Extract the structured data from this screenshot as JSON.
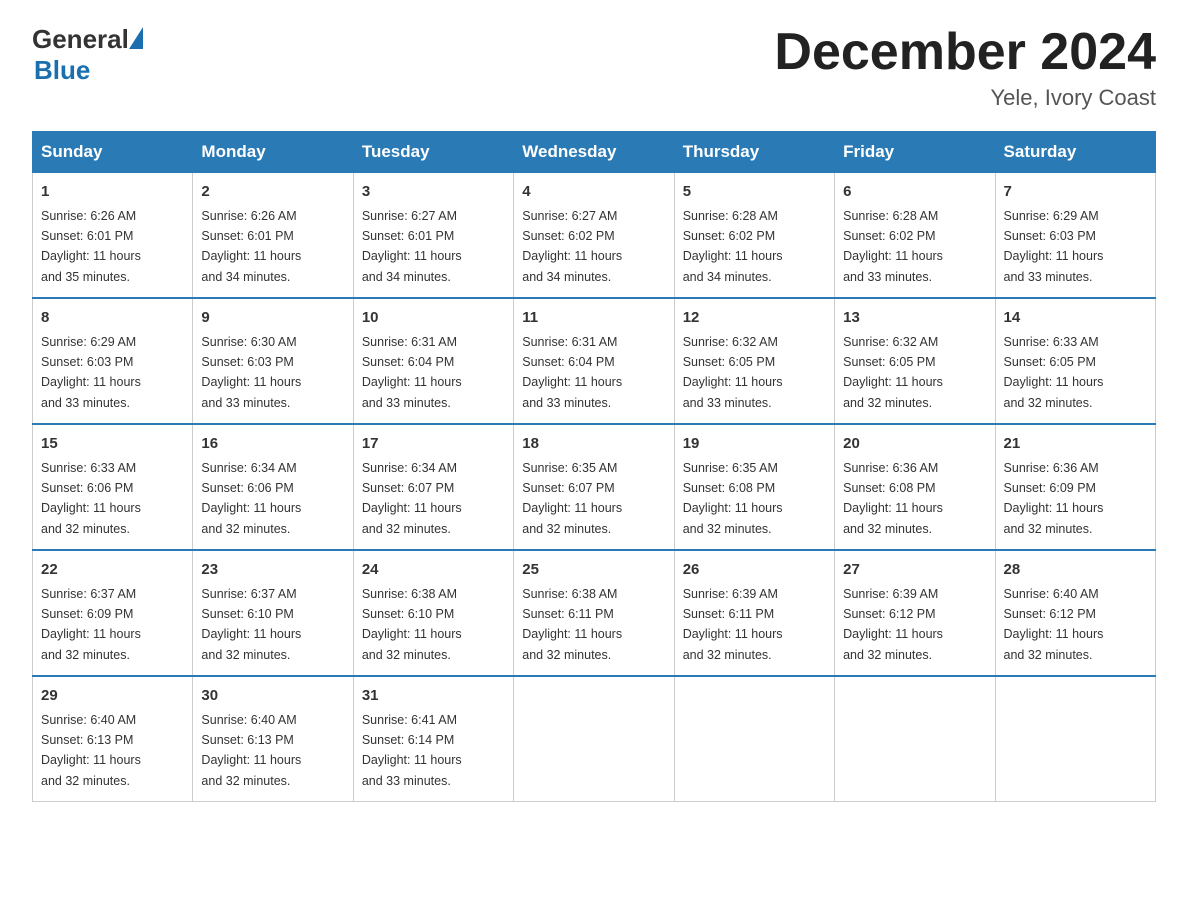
{
  "header": {
    "logo_general": "General",
    "logo_blue": "Blue",
    "month_title": "December 2024",
    "location": "Yele, Ivory Coast"
  },
  "days_of_week": [
    "Sunday",
    "Monday",
    "Tuesday",
    "Wednesday",
    "Thursday",
    "Friday",
    "Saturday"
  ],
  "weeks": [
    [
      {
        "day": "1",
        "sunrise": "6:26 AM",
        "sunset": "6:01 PM",
        "daylight": "11 hours and 35 minutes."
      },
      {
        "day": "2",
        "sunrise": "6:26 AM",
        "sunset": "6:01 PM",
        "daylight": "11 hours and 34 minutes."
      },
      {
        "day": "3",
        "sunrise": "6:27 AM",
        "sunset": "6:01 PM",
        "daylight": "11 hours and 34 minutes."
      },
      {
        "day": "4",
        "sunrise": "6:27 AM",
        "sunset": "6:02 PM",
        "daylight": "11 hours and 34 minutes."
      },
      {
        "day": "5",
        "sunrise": "6:28 AM",
        "sunset": "6:02 PM",
        "daylight": "11 hours and 34 minutes."
      },
      {
        "day": "6",
        "sunrise": "6:28 AM",
        "sunset": "6:02 PM",
        "daylight": "11 hours and 33 minutes."
      },
      {
        "day": "7",
        "sunrise": "6:29 AM",
        "sunset": "6:03 PM",
        "daylight": "11 hours and 33 minutes."
      }
    ],
    [
      {
        "day": "8",
        "sunrise": "6:29 AM",
        "sunset": "6:03 PM",
        "daylight": "11 hours and 33 minutes."
      },
      {
        "day": "9",
        "sunrise": "6:30 AM",
        "sunset": "6:03 PM",
        "daylight": "11 hours and 33 minutes."
      },
      {
        "day": "10",
        "sunrise": "6:31 AM",
        "sunset": "6:04 PM",
        "daylight": "11 hours and 33 minutes."
      },
      {
        "day": "11",
        "sunrise": "6:31 AM",
        "sunset": "6:04 PM",
        "daylight": "11 hours and 33 minutes."
      },
      {
        "day": "12",
        "sunrise": "6:32 AM",
        "sunset": "6:05 PM",
        "daylight": "11 hours and 33 minutes."
      },
      {
        "day": "13",
        "sunrise": "6:32 AM",
        "sunset": "6:05 PM",
        "daylight": "11 hours and 32 minutes."
      },
      {
        "day": "14",
        "sunrise": "6:33 AM",
        "sunset": "6:05 PM",
        "daylight": "11 hours and 32 minutes."
      }
    ],
    [
      {
        "day": "15",
        "sunrise": "6:33 AM",
        "sunset": "6:06 PM",
        "daylight": "11 hours and 32 minutes."
      },
      {
        "day": "16",
        "sunrise": "6:34 AM",
        "sunset": "6:06 PM",
        "daylight": "11 hours and 32 minutes."
      },
      {
        "day": "17",
        "sunrise": "6:34 AM",
        "sunset": "6:07 PM",
        "daylight": "11 hours and 32 minutes."
      },
      {
        "day": "18",
        "sunrise": "6:35 AM",
        "sunset": "6:07 PM",
        "daylight": "11 hours and 32 minutes."
      },
      {
        "day": "19",
        "sunrise": "6:35 AM",
        "sunset": "6:08 PM",
        "daylight": "11 hours and 32 minutes."
      },
      {
        "day": "20",
        "sunrise": "6:36 AM",
        "sunset": "6:08 PM",
        "daylight": "11 hours and 32 minutes."
      },
      {
        "day": "21",
        "sunrise": "6:36 AM",
        "sunset": "6:09 PM",
        "daylight": "11 hours and 32 minutes."
      }
    ],
    [
      {
        "day": "22",
        "sunrise": "6:37 AM",
        "sunset": "6:09 PM",
        "daylight": "11 hours and 32 minutes."
      },
      {
        "day": "23",
        "sunrise": "6:37 AM",
        "sunset": "6:10 PM",
        "daylight": "11 hours and 32 minutes."
      },
      {
        "day": "24",
        "sunrise": "6:38 AM",
        "sunset": "6:10 PM",
        "daylight": "11 hours and 32 minutes."
      },
      {
        "day": "25",
        "sunrise": "6:38 AM",
        "sunset": "6:11 PM",
        "daylight": "11 hours and 32 minutes."
      },
      {
        "day": "26",
        "sunrise": "6:39 AM",
        "sunset": "6:11 PM",
        "daylight": "11 hours and 32 minutes."
      },
      {
        "day": "27",
        "sunrise": "6:39 AM",
        "sunset": "6:12 PM",
        "daylight": "11 hours and 32 minutes."
      },
      {
        "day": "28",
        "sunrise": "6:40 AM",
        "sunset": "6:12 PM",
        "daylight": "11 hours and 32 minutes."
      }
    ],
    [
      {
        "day": "29",
        "sunrise": "6:40 AM",
        "sunset": "6:13 PM",
        "daylight": "11 hours and 32 minutes."
      },
      {
        "day": "30",
        "sunrise": "6:40 AM",
        "sunset": "6:13 PM",
        "daylight": "11 hours and 32 minutes."
      },
      {
        "day": "31",
        "sunrise": "6:41 AM",
        "sunset": "6:14 PM",
        "daylight": "11 hours and 33 minutes."
      },
      null,
      null,
      null,
      null
    ]
  ],
  "labels": {
    "sunrise": "Sunrise:",
    "sunset": "Sunset:",
    "daylight": "Daylight:"
  }
}
